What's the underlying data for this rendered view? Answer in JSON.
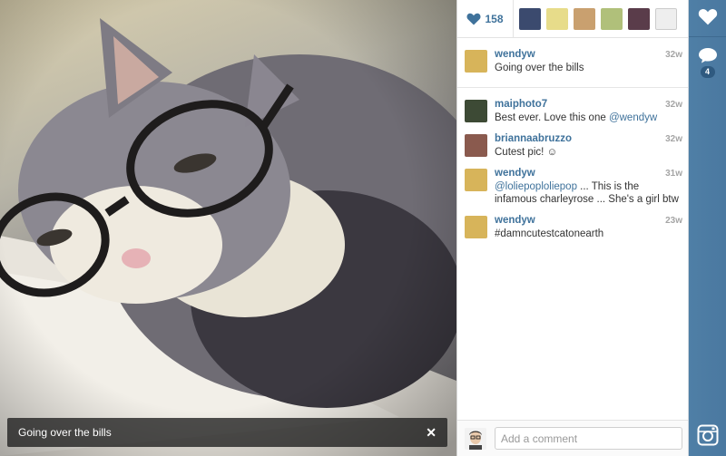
{
  "photo": {
    "caption": "Going over the bills",
    "close_icon": "close-icon"
  },
  "likes": {
    "count": "158",
    "icon": "heart-icon",
    "color": "#3f729b"
  },
  "likers": [
    {
      "color": "#3b4a6e"
    },
    {
      "color": "#e7dc8a"
    },
    {
      "color": "#c9a06f"
    },
    {
      "color": "#b0c07a"
    },
    {
      "color": "#5a3c4a"
    },
    {
      "color": "#eeeeee"
    }
  ],
  "comments": [
    {
      "user": "wendyw",
      "time": "32w",
      "text": "Going over the bills",
      "avatar": "#d7b45a"
    },
    {
      "user": "maiphoto7",
      "time": "32w",
      "text": "Best ever. Love this one ",
      "mention": "@wendyw",
      "avatar": "#3d4a35"
    },
    {
      "user": "briannaabruzzo",
      "time": "32w",
      "text": "Cutest pic! ☺",
      "avatar": "#8a5a4e"
    },
    {
      "user": "wendyw",
      "time": "31w",
      "mention": "@loliepoploliepop",
      "text": " ... This is the infamous charleyrose ... She's a girl btw",
      "avatar": "#d7b45a"
    },
    {
      "user": "wendyw",
      "time": "23w",
      "text": "#damncutestcatonearth",
      "avatar": "#d7b45a"
    }
  ],
  "add_comment": {
    "placeholder": "Add a comment"
  },
  "rail": {
    "like_icon": "heart-icon",
    "comment_icon": "speech-bubble-icon",
    "comment_count": "4",
    "camera_icon": "instagram-camera-icon",
    "background": "#4a78a0"
  }
}
